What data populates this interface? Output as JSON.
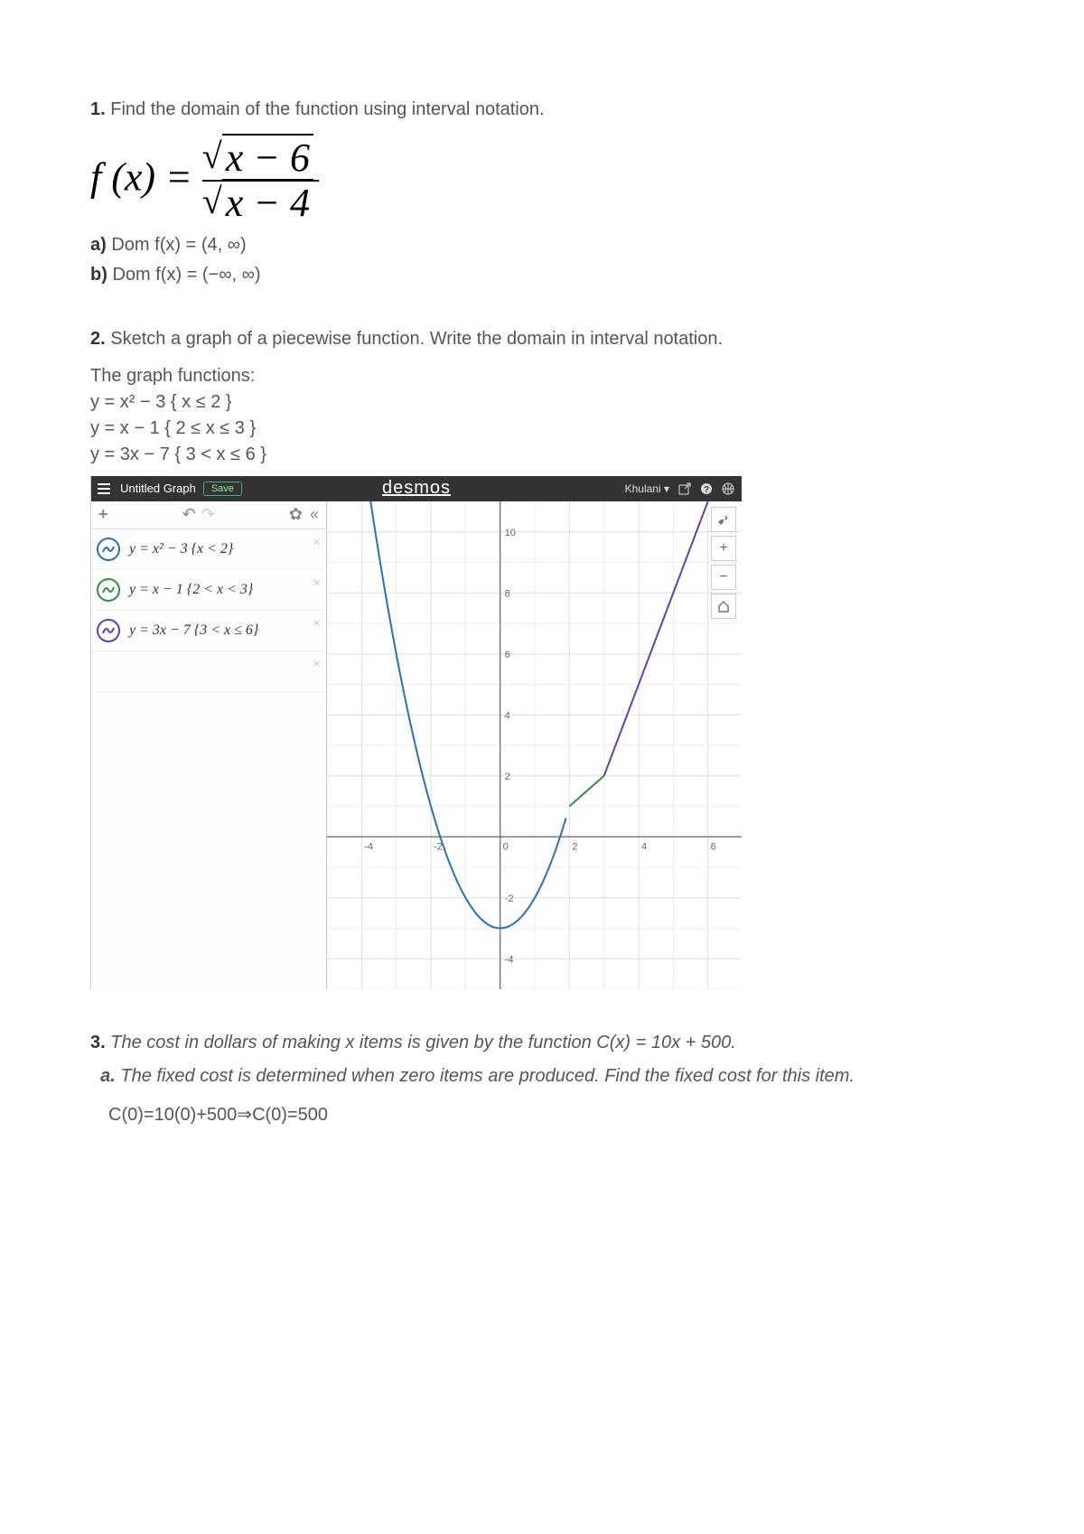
{
  "q1": {
    "number": "1.",
    "prompt": "Find the domain of the function using interval notation.",
    "formula_lhs": "f (x) =",
    "num_radicand": "x − 6",
    "den_radicand": "x − 4",
    "a_label": "a)",
    "a_text": "Dom f(x) = (4, ∞)",
    "b_label": "b)",
    "b_text": "Dom f(x) = (−∞, ∞)"
  },
  "q2": {
    "number": "2.",
    "prompt": "Sketch a graph of a piecewise function. Write the domain in interval notation.",
    "intro": "The graph functions:",
    "pieces": [
      "y = x² − 3  { x ≤ 2 }",
      "y = x − 1 { 2 ≤ x ≤ 3 }",
      "y = 3x − 7 { 3 < x ≤ 6 }"
    ]
  },
  "desmos": {
    "title": "Untitled Graph",
    "save": "Save",
    "logo": "desmos",
    "user": "Khulani",
    "expressions": [
      {
        "color": "#2d70b3",
        "text": "y = x² − 3 {x < 2}"
      },
      {
        "color": "#388c46",
        "text": "y = x − 1 {2 < x < 3}"
      },
      {
        "color": "#6042a6",
        "text": "y = 3x − 7 {3 < x ≤ 6}"
      }
    ],
    "axis_ticks_x": [
      "-4",
      "-2",
      "0",
      "2",
      "4",
      "6"
    ],
    "axis_ticks_y": [
      "-4",
      "-2",
      "2",
      "4",
      "6",
      "8",
      "10"
    ]
  },
  "q3": {
    "number": "3.",
    "prompt": "The cost in dollars of making x items is given by the function C(x) = 10x + 500.",
    "a_label": "a.",
    "a_text": "The fixed cost is determined when zero items are produced. Find the fixed cost for this item.",
    "answer": "C(0)=10(0)+500⇒C(0)=500"
  },
  "chart_data": {
    "type": "line",
    "title": "",
    "xlabel": "",
    "ylabel": "",
    "xlim": [
      -5,
      7
    ],
    "ylim": [
      -5,
      11
    ],
    "series": [
      {
        "name": "y = x² − 3 {x ≤ 2}",
        "color": "#2d70b3",
        "x": [
          -4,
          -3,
          -2,
          -1,
          0,
          1,
          2
        ],
        "values": [
          13,
          6,
          1,
          -2,
          -3,
          -2,
          1
        ]
      },
      {
        "name": "y = x − 1 {2 ≤ x ≤ 3}",
        "color": "#388c46",
        "x": [
          2,
          3
        ],
        "values": [
          1,
          2
        ]
      },
      {
        "name": "y = 3x − 7 {3 < x ≤ 6}",
        "color": "#6042a6",
        "x": [
          3,
          4,
          5,
          6
        ],
        "values": [
          2,
          5,
          8,
          11
        ]
      }
    ]
  }
}
